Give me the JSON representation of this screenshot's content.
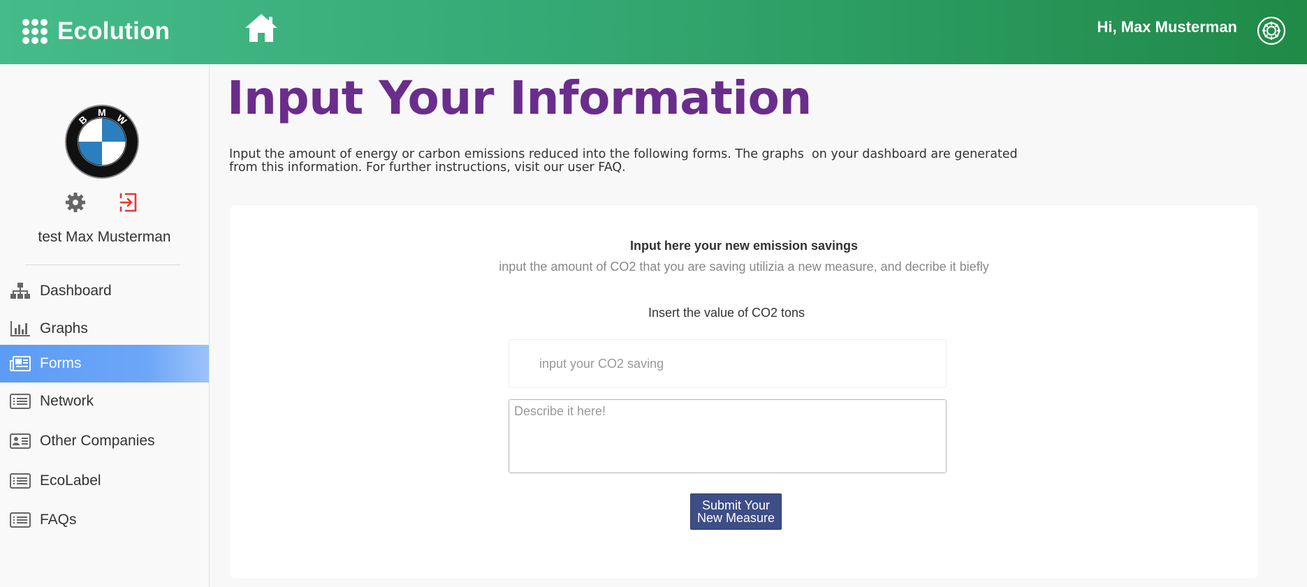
{
  "header": {
    "app_name": "Ecolution",
    "greeting": "Hi, Max Musterman",
    "brand_color": "#34a873"
  },
  "sidebar": {
    "company_logo_text": "BMW",
    "user_name": "test Max Musterman",
    "items": [
      {
        "label": "Dashboard",
        "icon": "sitemap-icon",
        "active": false
      },
      {
        "label": "Graphs",
        "icon": "bar-chart-icon",
        "active": false
      },
      {
        "label": "Forms",
        "icon": "newspaper-icon",
        "active": true
      },
      {
        "label": "Network",
        "icon": "list-icon",
        "active": false
      },
      {
        "label": "Other Companies",
        "icon": "id-card-icon",
        "active": false
      },
      {
        "label": "EcoLabel",
        "icon": "list-icon",
        "active": false
      },
      {
        "label": "FAQs",
        "icon": "list-icon",
        "active": false
      }
    ]
  },
  "main": {
    "title": "Input Your Information",
    "intro_line1": "Input the amount of energy or carbon emissions reduced into the following forms. The graphs  on your dashboard are generated",
    "intro_line2": "from this information. For further instructions, visit our user FAQ.",
    "form": {
      "heading": "Input here your new emission savings",
      "subheading": "input the amount of CO2 that you are saving utilizia a new measure, and decribe it biefly",
      "co2_label": "Insert the value of CO2 tons",
      "co2_placeholder": "input your CO2 saving",
      "co2_value": "",
      "description_placeholder": "Describe it here!",
      "description_value": "",
      "submit_line1": "Submit Your",
      "submit_line2": "New Measure"
    },
    "title_color": "#6a2d8c",
    "submit_color": "#3d4d86"
  }
}
